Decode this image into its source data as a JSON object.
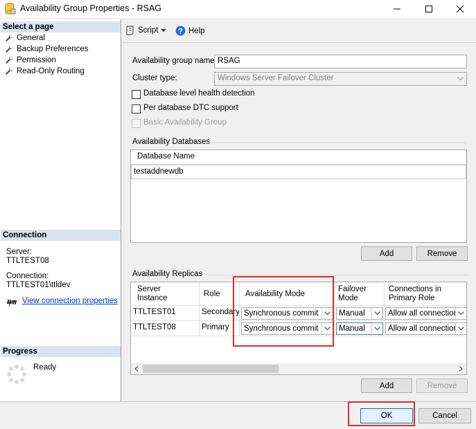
{
  "window": {
    "title": "Availability Group Properties - RSAG"
  },
  "left_pane": {
    "select_page_header": "Select a page",
    "pages": [
      {
        "label": "General"
      },
      {
        "label": "Backup Preferences"
      },
      {
        "label": "Permission"
      },
      {
        "label": "Read-Only Routing"
      }
    ],
    "connection_header": "Connection",
    "server_label": "Server:",
    "server_value": "TTLTEST08",
    "connection_label": "Connection:",
    "connection_value": "TTLTEST01\\ttldev",
    "view_connection_link": "View connection properties",
    "progress_header": "Progress",
    "progress_status": "Ready"
  },
  "toolbar": {
    "script_label": "Script",
    "help_label": "Help"
  },
  "general": {
    "ag_name_label": "Availability group name:",
    "ag_name_value": "RSAG",
    "cluster_type_label": "Cluster type:",
    "cluster_type_value": "Windows Server Failover Cluster",
    "db_health_label": "Database level health detection",
    "dtc_label": "Per database DTC support",
    "basic_ag_label": "Basic Availability Group"
  },
  "databases": {
    "section_label": "Availability Databases",
    "column_header": "Database Name",
    "rows": [
      "testaddnewdb"
    ],
    "add_label": "Add",
    "remove_label": "Remove"
  },
  "replicas": {
    "section_label": "Availability Replicas",
    "headers": {
      "server_instance": "Server Instance",
      "role": "Role",
      "availability_mode": "Availability Mode",
      "failover_mode": "Failover Mode",
      "connections_primary": "Connections in Primary Role"
    },
    "rows": [
      {
        "server": "TTLTEST01",
        "role": "Secondary",
        "availability_mode": "Synchronous commit",
        "failover_mode": "Manual",
        "connections": "Allow all connections"
      },
      {
        "server": "TTLTEST08",
        "role": "Primary",
        "availability_mode": "Synchronous commit",
        "failover_mode": "Manual",
        "connections": "Allow all connections"
      }
    ],
    "add_label": "Add",
    "remove_label": "Remove"
  },
  "footer": {
    "ok_label": "OK",
    "cancel_label": "Cancel"
  },
  "colors": {
    "highlight": "#e02b2b",
    "link": "#0033cc",
    "section_header": "#dbe3ef"
  }
}
